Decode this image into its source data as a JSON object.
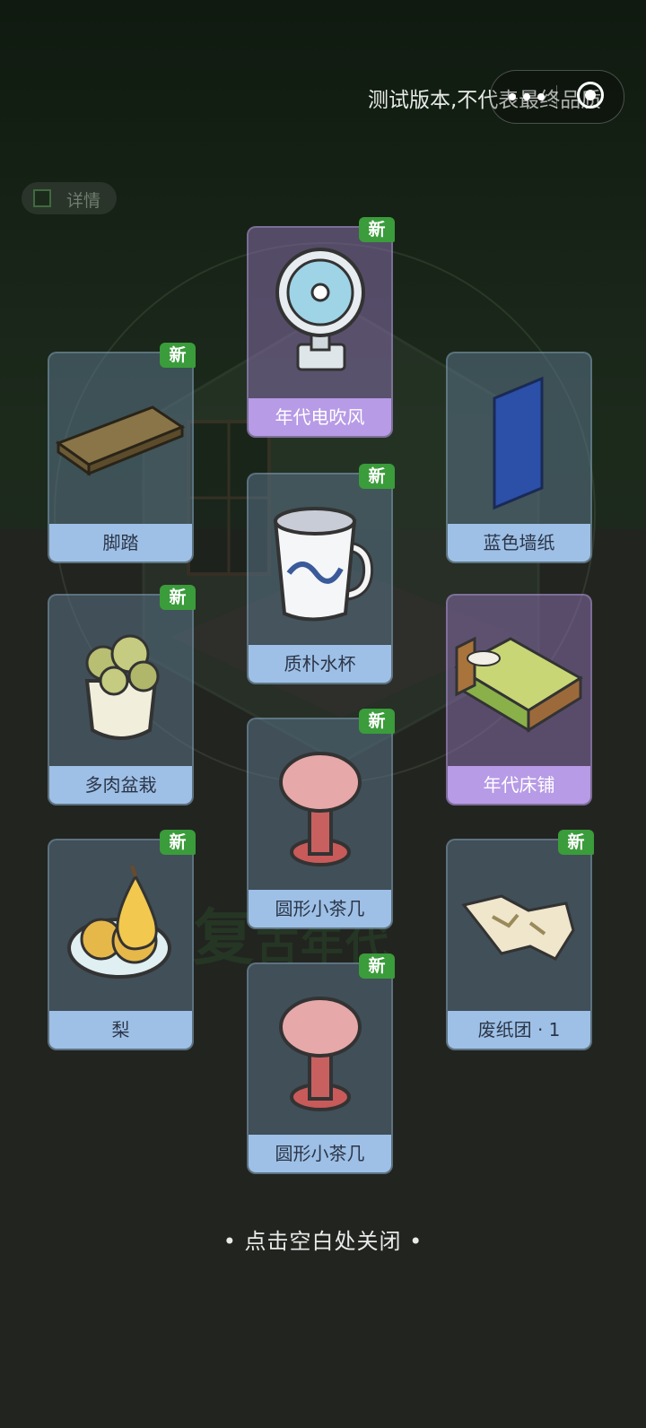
{
  "banner": {
    "test_notice": "测试版本,不代表最终品质"
  },
  "detail": {
    "label": "详情"
  },
  "background_title": {
    "main": "复",
    "rest": "古年代"
  },
  "new_badge": "新",
  "items": [
    {
      "name": "年代电吹风",
      "rarity": "purple",
      "is_new": true,
      "icon": "fan-icon"
    },
    {
      "name": "脚踏",
      "rarity": "blue",
      "is_new": true,
      "icon": "footstool-icon"
    },
    {
      "name": "蓝色墙纸",
      "rarity": "blue",
      "is_new": false,
      "icon": "wallpaper-icon"
    },
    {
      "name": "质朴水杯",
      "rarity": "blue",
      "is_new": true,
      "icon": "mug-icon"
    },
    {
      "name": "多肉盆栽",
      "rarity": "blue",
      "is_new": true,
      "icon": "succulent-icon"
    },
    {
      "name": "年代床铺",
      "rarity": "purple",
      "is_new": false,
      "icon": "bed-icon"
    },
    {
      "name": "圆形小茶几",
      "rarity": "blue",
      "is_new": true,
      "icon": "round-table-icon"
    },
    {
      "name": "梨",
      "rarity": "blue",
      "is_new": true,
      "icon": "pear-icon"
    },
    {
      "name": "废纸团 · 1",
      "rarity": "blue",
      "is_new": true,
      "icon": "paper-ball-icon"
    },
    {
      "name": "圆形小茶几",
      "rarity": "blue",
      "is_new": true,
      "icon": "round-table-icon"
    }
  ],
  "footer": {
    "close_hint": "• 点击空白处关闭 •"
  },
  "colors": {
    "label_blue": "#9ec0e6",
    "label_purple": "#b79be6",
    "badge_green": "#3a9c3a"
  }
}
